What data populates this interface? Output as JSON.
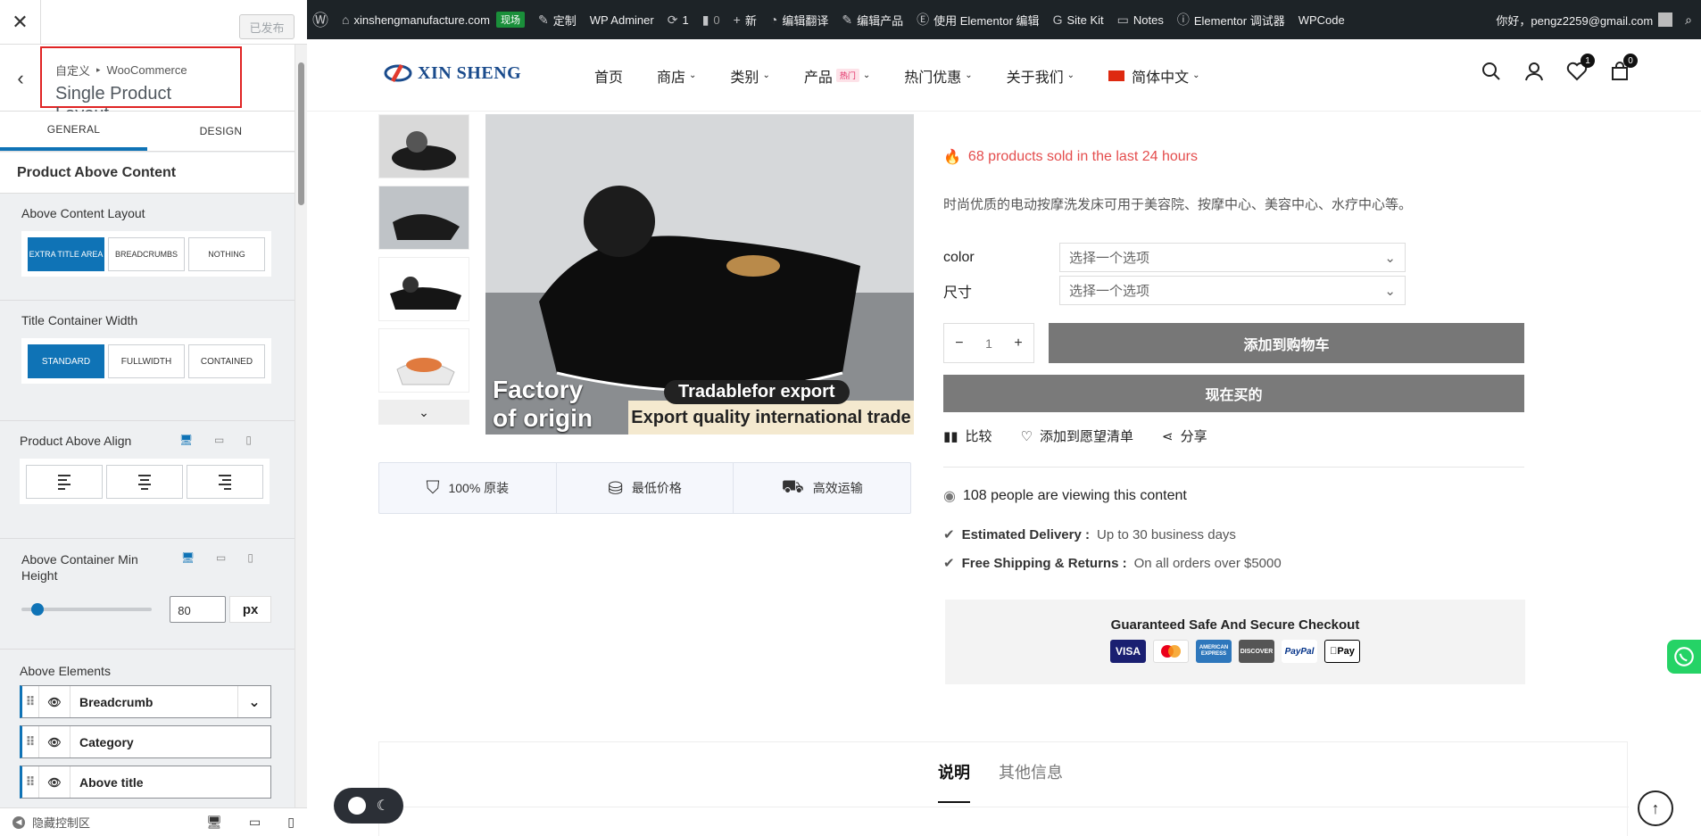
{
  "customizer": {
    "close_icon": "close-icon",
    "publish_label": "已发布",
    "breadcrumb_root": "自定义",
    "breadcrumb_section": "WooCommerce",
    "panel_title": "Single Product Layout",
    "tabs": [
      {
        "label": "GENERAL",
        "active": true
      },
      {
        "label": "DESIGN",
        "active": false
      }
    ],
    "section_title": "Product Above Content",
    "above_content_layout": {
      "label": "Above Content Layout",
      "options": [
        {
          "label": "EXTRA TITLE AREA",
          "selected": true
        },
        {
          "label": "BREADCRUMBS",
          "selected": false
        },
        {
          "label": "NOTHING",
          "selected": false
        }
      ]
    },
    "title_container_width": {
      "label": "Title Container Width",
      "options": [
        {
          "label": "STANDARD",
          "selected": true
        },
        {
          "label": "FULLWIDTH",
          "selected": false
        },
        {
          "label": "CONTAINED",
          "selected": false
        }
      ]
    },
    "product_above_align": {
      "label": "Product Above Align",
      "options": [
        "align-left-icon",
        "align-center-icon",
        "align-right-icon"
      ]
    },
    "above_container_min_height": {
      "label": "Above Container Min Height",
      "value": "80",
      "unit": "px",
      "slider_fraction": 0.08
    },
    "above_elements": {
      "label": "Above Elements",
      "items": [
        "Breadcrumb",
        "Category",
        "Above title"
      ]
    },
    "footer_hide_label": "隐藏控制区"
  },
  "adminbar": {
    "items": [
      {
        "icon": "wordpress-icon",
        "label": ""
      },
      {
        "icon": "home-icon",
        "label": "xinshengmanufacture.com"
      },
      {
        "icon": "",
        "label": "现场"
      },
      {
        "icon": "brush-icon",
        "label": "定制"
      },
      {
        "icon": "",
        "label": "WP Adminer"
      },
      {
        "icon": "refresh-icon",
        "label": "1"
      },
      {
        "icon": "comment-icon",
        "label": "0"
      },
      {
        "icon": "plus-icon",
        "label": "新"
      },
      {
        "icon": "translate-icon",
        "label": "编辑翻译"
      },
      {
        "icon": "edit-icon",
        "label": "编辑产品"
      },
      {
        "icon": "elementor-icon",
        "label": "使用 Elementor 编辑"
      },
      {
        "icon": "google-icon",
        "label": "Site Kit"
      },
      {
        "icon": "notes-icon",
        "label": "Notes"
      },
      {
        "icon": "info-icon",
        "label": "Elementor 调试器"
      },
      {
        "icon": "",
        "label": "WPCode"
      }
    ],
    "greeting": "你好，pengz2259@gmail.com"
  },
  "header": {
    "logo_text": "XIN SHENG",
    "nav": [
      {
        "label": "首页",
        "caret": false
      },
      {
        "label": "商店",
        "caret": true
      },
      {
        "label": "类别",
        "caret": true
      },
      {
        "label": "产品",
        "caret": true,
        "badge": "热门"
      },
      {
        "label": "热门优惠",
        "caret": true
      },
      {
        "label": "关于我们",
        "caret": true
      },
      {
        "label": "简体中文",
        "caret": true,
        "flag": true
      }
    ],
    "wishlist_count": "1",
    "cart_count": "0"
  },
  "gallery": {
    "badge_left_line1": "Factory",
    "badge_left_line2": "of origin",
    "badge_pill": "Tradablefor export",
    "badge_strip": "Export quality international trade"
  },
  "trust": [
    {
      "icon": "shield-icon",
      "label": "100% 原装"
    },
    {
      "icon": "coins-icon",
      "label": "最低价格"
    },
    {
      "icon": "truck-icon",
      "label": "高效运输"
    }
  ],
  "summary": {
    "sold_text": "68 products sold in the last 24 hours",
    "description": "时尚优质的电动按摩洗发床可用于美容院、按摩中心、美容中心、水疗中心等。",
    "variations": [
      {
        "label": "color",
        "placeholder": "选择一个选项"
      },
      {
        "label": "尺寸",
        "placeholder": "选择一个选项"
      }
    ],
    "qty": "1",
    "add_to_cart": "添加到购物车",
    "buy_now": "现在买的",
    "actions": [
      {
        "icon": "compare-icon",
        "label": "比较"
      },
      {
        "icon": "heart-icon",
        "label": "添加到愿望清单"
      },
      {
        "icon": "share-icon",
        "label": "分享"
      }
    ],
    "viewing": "108 people are viewing this content",
    "delivery_label": "Estimated Delivery :",
    "delivery_value": "Up to 30 business days",
    "shipping_label": "Free Shipping & Returns :",
    "shipping_value": "On all orders over $5000",
    "checkout_title": "Guaranteed Safe And Secure Checkout",
    "payments": [
      {
        "name": "visa-icon",
        "label": "VISA",
        "color": "#1a1f71"
      },
      {
        "name": "mastercard-icon",
        "label": "",
        "color": "#ffffff"
      },
      {
        "name": "amex-icon",
        "label": "AMERICAN EXPRESS",
        "color": "#2e77bc"
      },
      {
        "name": "discover-icon",
        "label": "DISCOVER",
        "color": "#555555"
      },
      {
        "name": "paypal-icon",
        "label": "PayPal",
        "color": "#ffffff"
      },
      {
        "name": "applepay-icon",
        "label": "Pay",
        "color": "#ffffff"
      }
    ]
  },
  "product_tabs": [
    {
      "label": "说明",
      "active": true
    },
    {
      "label": "其他信息",
      "active": false
    }
  ],
  "colors": {
    "accent": "#0f73b6",
    "adminbar": "#1d2327",
    "sold": "#e44d4d",
    "button": "#777777"
  }
}
